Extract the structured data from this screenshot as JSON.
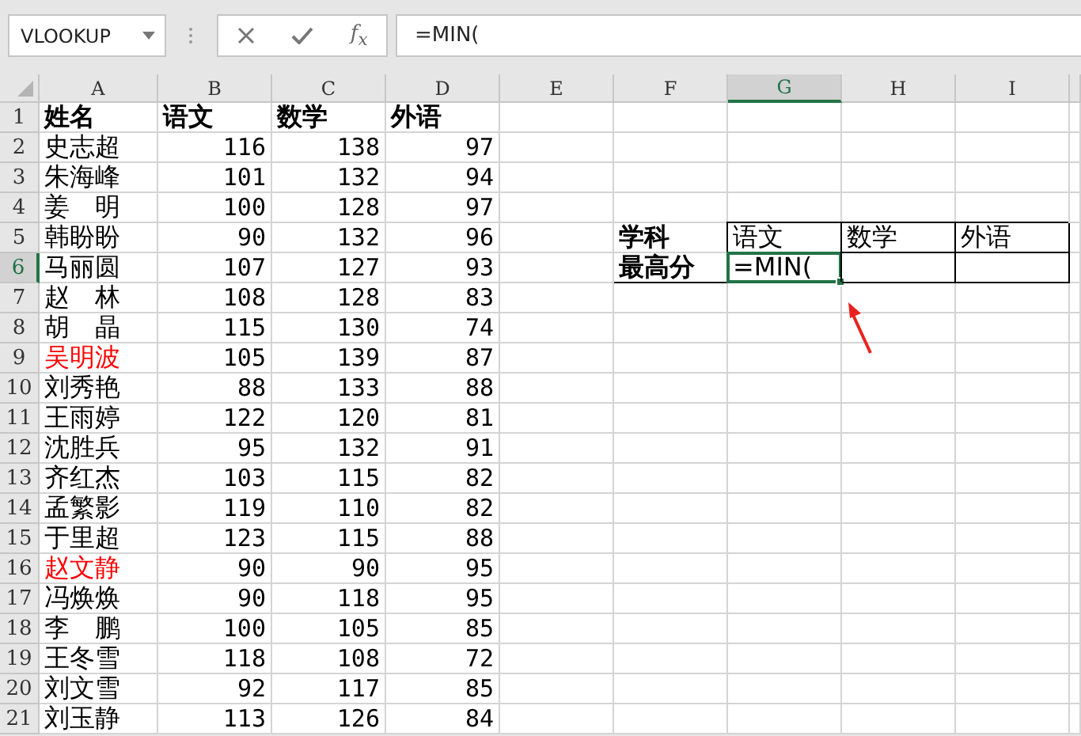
{
  "name_box": {
    "value": "VLOOKUP"
  },
  "formula_bar": {
    "function_label": "f$_{x}$",
    "value": "=MIN("
  },
  "column_headers": [
    {
      "label": "A",
      "selected": false
    },
    {
      "label": "B",
      "selected": false
    },
    {
      "label": "C",
      "selected": false
    },
    {
      "label": "D",
      "selected": false
    },
    {
      "label": "E",
      "selected": false
    },
    {
      "label": "F",
      "selected": false
    },
    {
      "label": "G",
      "selected": true
    },
    {
      "label": "H",
      "selected": false
    },
    {
      "label": "I",
      "selected": false
    }
  ],
  "rows": [
    {
      "number": "1",
      "selected": false,
      "kind": "header",
      "color": "#000000",
      "cells": [
        {
          "text": "姓名"
        },
        {
          "text": "语文"
        },
        {
          "text": "数学"
        },
        {
          "text": "外语"
        },
        null,
        null,
        null,
        null,
        null
      ]
    },
    {
      "number": "2",
      "selected": false,
      "kind": "data",
      "color": "#000000",
      "cells": [
        {
          "text": "史志超"
        },
        {
          "text": "116"
        },
        {
          "text": "138"
        },
        {
          "text": "97"
        },
        null,
        null,
        null,
        null,
        null
      ]
    },
    {
      "number": "3",
      "selected": false,
      "kind": "data",
      "color": "#000000",
      "cells": [
        {
          "text": "朱海峰"
        },
        {
          "text": "101"
        },
        {
          "text": "132"
        },
        {
          "text": "94"
        },
        null,
        null,
        null,
        null,
        null
      ]
    },
    {
      "number": "4",
      "selected": false,
      "kind": "data",
      "color": "#000000",
      "cells": [
        {
          "text": "姜　明"
        },
        {
          "text": "100"
        },
        {
          "text": "128"
        },
        {
          "text": "97"
        },
        null,
        null,
        null,
        null,
        null
      ]
    },
    {
      "number": "5",
      "selected": false,
      "kind": "data",
      "color": "#000000",
      "cells": [
        {
          "text": "韩盼盼"
        },
        {
          "text": "90"
        },
        {
          "text": "132"
        },
        {
          "text": "96"
        },
        null,
        {
          "text": "学科",
          "bold": true
        },
        {
          "text": "语文",
          "boxed": true
        },
        {
          "text": "数学",
          "boxed": true
        },
        {
          "text": "外语",
          "boxed": true
        }
      ]
    },
    {
      "number": "6",
      "selected": true,
      "kind": "data",
      "color": "#000000",
      "cells": [
        {
          "text": "马丽圆"
        },
        {
          "text": "107"
        },
        {
          "text": "127"
        },
        {
          "text": "93"
        },
        null,
        {
          "text": "最高分",
          "bold": true,
          "underlined": true
        },
        {
          "text": "=MIN(",
          "boxed": true,
          "active": true
        },
        {
          "boxed": true
        },
        {
          "boxed": true
        }
      ]
    },
    {
      "number": "7",
      "selected": false,
      "kind": "data",
      "color": "#000000",
      "cells": [
        {
          "text": "赵　林"
        },
        {
          "text": "108"
        },
        {
          "text": "128"
        },
        {
          "text": "83"
        },
        null,
        null,
        null,
        null,
        null
      ]
    },
    {
      "number": "8",
      "selected": false,
      "kind": "data",
      "color": "#000000",
      "cells": [
        {
          "text": "胡　晶"
        },
        {
          "text": "115"
        },
        {
          "text": "130"
        },
        {
          "text": "74"
        },
        null,
        null,
        null,
        null,
        null
      ]
    },
    {
      "number": "9",
      "selected": false,
      "kind": "data",
      "color": "#ff0000",
      "cells": [
        {
          "text": "吴明波"
        },
        {
          "text": "105"
        },
        {
          "text": "139"
        },
        {
          "text": "87"
        },
        null,
        null,
        null,
        null,
        null
      ]
    },
    {
      "number": "10",
      "selected": false,
      "kind": "data",
      "color": "#000000",
      "cells": [
        {
          "text": "刘秀艳"
        },
        {
          "text": "88"
        },
        {
          "text": "133"
        },
        {
          "text": "88"
        },
        null,
        null,
        null,
        null,
        null
      ]
    },
    {
      "number": "11",
      "selected": false,
      "kind": "data",
      "color": "#000000",
      "cells": [
        {
          "text": "王雨婷"
        },
        {
          "text": "122"
        },
        {
          "text": "120"
        },
        {
          "text": "81"
        },
        null,
        null,
        null,
        null,
        null
      ]
    },
    {
      "number": "12",
      "selected": false,
      "kind": "data",
      "color": "#000000",
      "cells": [
        {
          "text": "沈胜兵"
        },
        {
          "text": "95"
        },
        {
          "text": "132"
        },
        {
          "text": "91"
        },
        null,
        null,
        null,
        null,
        null
      ]
    },
    {
      "number": "13",
      "selected": false,
      "kind": "data",
      "color": "#000000",
      "cells": [
        {
          "text": "齐红杰"
        },
        {
          "text": "103"
        },
        {
          "text": "115"
        },
        {
          "text": "82"
        },
        null,
        null,
        null,
        null,
        null
      ]
    },
    {
      "number": "14",
      "selected": false,
      "kind": "data",
      "color": "#000000",
      "cells": [
        {
          "text": "孟繁影"
        },
        {
          "text": "119"
        },
        {
          "text": "110"
        },
        {
          "text": "82"
        },
        null,
        null,
        null,
        null,
        null
      ]
    },
    {
      "number": "15",
      "selected": false,
      "kind": "data",
      "color": "#000000",
      "cells": [
        {
          "text": "于里超"
        },
        {
          "text": "123"
        },
        {
          "text": "115"
        },
        {
          "text": "88"
        },
        null,
        null,
        null,
        null,
        null
      ]
    },
    {
      "number": "16",
      "selected": false,
      "kind": "data",
      "color": "#ff0000",
      "cells": [
        {
          "text": "赵文静"
        },
        {
          "text": "90"
        },
        {
          "text": "90"
        },
        {
          "text": "95"
        },
        null,
        null,
        null,
        null,
        null
      ]
    },
    {
      "number": "17",
      "selected": false,
      "kind": "data",
      "color": "#000000",
      "cells": [
        {
          "text": "冯焕焕"
        },
        {
          "text": "90"
        },
        {
          "text": "118"
        },
        {
          "text": "95"
        },
        null,
        null,
        null,
        null,
        null
      ]
    },
    {
      "number": "18",
      "selected": false,
      "kind": "data",
      "color": "#000000",
      "cells": [
        {
          "text": "李　鹏"
        },
        {
          "text": "100"
        },
        {
          "text": "105"
        },
        {
          "text": "85"
        },
        null,
        null,
        null,
        null,
        null
      ]
    },
    {
      "number": "19",
      "selected": false,
      "kind": "data",
      "color": "#000000",
      "cells": [
        {
          "text": "王冬雪"
        },
        {
          "text": "118"
        },
        {
          "text": "108"
        },
        {
          "text": "72"
        },
        null,
        null,
        null,
        null,
        null
      ]
    },
    {
      "number": "20",
      "selected": false,
      "kind": "data",
      "color": "#000000",
      "cells": [
        {
          "text": "刘文雪"
        },
        {
          "text": "92"
        },
        {
          "text": "117"
        },
        {
          "text": "85"
        },
        null,
        null,
        null,
        null,
        null
      ]
    },
    {
      "number": "21",
      "selected": false,
      "kind": "data",
      "color": "#000000",
      "cells": [
        {
          "text": "刘玉静"
        },
        {
          "text": "113"
        },
        {
          "text": "126"
        },
        {
          "text": "84"
        },
        null,
        null,
        null,
        null,
        null
      ]
    }
  ]
}
